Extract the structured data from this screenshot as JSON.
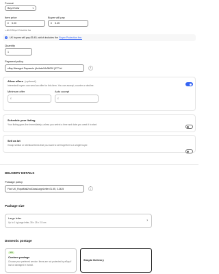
{
  "format": {
    "label": "Format",
    "value": "Buy it Now"
  },
  "pricing": {
    "item_price_label": "Item price",
    "item_price_currency": "£",
    "item_price_value": "5.00",
    "buyer_pay_label": "Buyer will pay",
    "buyer_pay_currency": "£",
    "buyer_pay_value": "5.45",
    "protection_note": "+ £0.45 Buyer Protection fee"
  },
  "info_banner": {
    "text": "UK buyers will pay £5.45, which includes the",
    "link": "Buyer Protection fee."
  },
  "quantity": {
    "label": "Quantity",
    "value": "1"
  },
  "payment_policy": {
    "label": "Payment policy",
    "value": "eBay Managed Payments (rfo4cde54c38000 (377 ltd"
  },
  "allow_offers": {
    "title": "Allow offers",
    "optional": "(optional)",
    "description": "Interested buyers can send an offer for this item. You can accept, counter or decline.",
    "min_offer_label": "Minimum offer",
    "min_offer_currency": "£",
    "auto_accept_label": "Auto accept",
    "auto_accept_currency": "£",
    "enabled": true
  },
  "schedule": {
    "title": "Schedule your listing",
    "description": "Your listing goes live immediately, unless you select a time and date you want it to start.",
    "enabled": false
  },
  "lot": {
    "title": "Sell as lot",
    "description": "Group similar or identical items that you want to sell together to a single buyer.",
    "enabled": false
  },
  "delivery": {
    "heading": "DELIVERY DETAILS",
    "postage_policy_label": "Postage policy",
    "postage_policy_value": "Flat: UK_RoyalMail2ndClassLargeLetter £1.55, 3.2425"
  },
  "package": {
    "heading": "Package size",
    "option_title": "Large letter",
    "option_desc": "Up to 1 kg large letter, 35 x 25 x 2.5 cm"
  },
  "domestic": {
    "heading": "Domestic postage",
    "custom_badge": "new",
    "custom_title": "Custom postage",
    "custom_desc": "Choose your preferred service. Items are not protected by eBay if lost or damaged in transit.",
    "simple_title": "Simple Delivery"
  },
  "icons": {
    "info": "info-icon",
    "more": "more-vertical-icon",
    "chevron": "chevron-down-icon",
    "arrow": "chevron-right-icon"
  },
  "colors": {
    "accent": "#3665f3",
    "info_bg": "#f7f7f7",
    "border": "#8f8f8f"
  }
}
